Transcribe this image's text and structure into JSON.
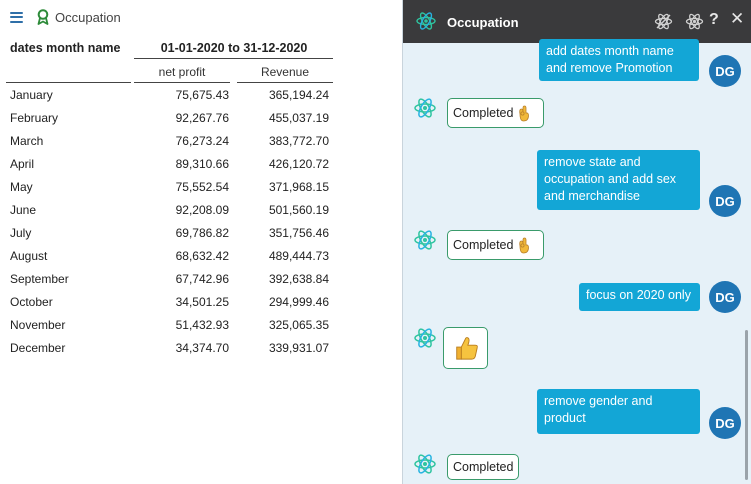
{
  "report": {
    "title": "Occupation",
    "row_header": "dates month name",
    "date_range": "01-01-2020 to 31-12-2020",
    "columns": [
      "net profit",
      "Revenue"
    ],
    "rows": [
      {
        "month": "January",
        "net_profit": "75,675.43",
        "revenue": "365,194.24"
      },
      {
        "month": "February",
        "net_profit": "92,267.76",
        "revenue": "455,037.19"
      },
      {
        "month": "March",
        "net_profit": "76,273.24",
        "revenue": "383,772.70"
      },
      {
        "month": "April",
        "net_profit": "89,310.66",
        "revenue": "426,120.72"
      },
      {
        "month": "May",
        "net_profit": "75,552.54",
        "revenue": "371,968.15"
      },
      {
        "month": "June",
        "net_profit": "92,208.09",
        "revenue": "501,560.19"
      },
      {
        "month": "July",
        "net_profit": "69,786.82",
        "revenue": "351,756.46"
      },
      {
        "month": "August",
        "net_profit": "68,632.42",
        "revenue": "489,444.73"
      },
      {
        "month": "September",
        "net_profit": "67,742.96",
        "revenue": "392,638.84"
      },
      {
        "month": "October",
        "net_profit": "34,501.25",
        "revenue": "294,999.46"
      },
      {
        "month": "November",
        "net_profit": "51,432.93",
        "revenue": "325,065.35"
      },
      {
        "month": "December",
        "net_profit": "34,374.70",
        "revenue": "339,931.07"
      }
    ]
  },
  "chat": {
    "title": "Occupation",
    "help_label": "?",
    "close_label": "✕",
    "user_initials": "DG",
    "messages": [
      {
        "from": "user",
        "text": "add dates month name and remove Promotion"
      },
      {
        "from": "bot",
        "text": "Completed",
        "emoji": "ok-hand"
      },
      {
        "from": "user",
        "text": "remove state and occupation and add sex and merchandise"
      },
      {
        "from": "bot",
        "text": "Completed",
        "emoji": "ok-hand"
      },
      {
        "from": "user",
        "text": "focus on 2020 only"
      },
      {
        "from": "bot",
        "text": "",
        "emoji": "thumbs-up"
      },
      {
        "from": "user",
        "text": "remove gender and product"
      },
      {
        "from": "bot",
        "text": "Completed",
        "emoji": ""
      }
    ]
  },
  "colors": {
    "accent_blue": "#13a6d6",
    "avatar_blue": "#1f75b4",
    "header_dark": "#3a3a3c",
    "chat_bg": "#e6f1f8",
    "bot_border": "#3a9b6b"
  }
}
